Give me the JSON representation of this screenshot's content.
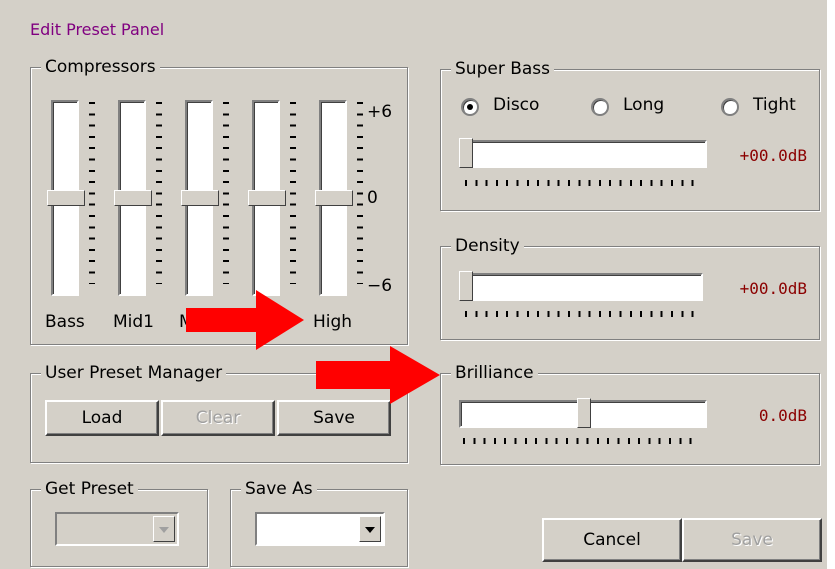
{
  "panel": {
    "title": "Edit Preset Panel"
  },
  "compressors": {
    "legend": "Compressors",
    "scale": [
      "+6",
      "0",
      "−6"
    ],
    "bands": [
      {
        "label": "Bass"
      },
      {
        "label": "Mid1"
      },
      {
        "label": "M"
      },
      {
        "label": ""
      },
      {
        "label": "High"
      }
    ]
  },
  "super_bass": {
    "legend": "Super Bass",
    "options": [
      "Disco",
      "Long",
      "Tight"
    ],
    "selected": "Disco",
    "value": "+00.0dB"
  },
  "density": {
    "legend": "Density",
    "value": "+00.0dB"
  },
  "brilliance": {
    "legend": "Brilliance",
    "value": "0.0dB"
  },
  "user_preset_manager": {
    "legend": "User Preset Manager",
    "load": "Load",
    "clear": "Clear",
    "save": "Save"
  },
  "get_preset": {
    "legend": "Get Preset",
    "value": ""
  },
  "save_as": {
    "legend": "Save As",
    "value": ""
  },
  "footer": {
    "cancel": "Cancel",
    "save": "Save"
  },
  "colors": {
    "title": "#800080",
    "db_value": "#8b0000",
    "arrow": "#ff0000",
    "face": "#d4d0c8"
  }
}
